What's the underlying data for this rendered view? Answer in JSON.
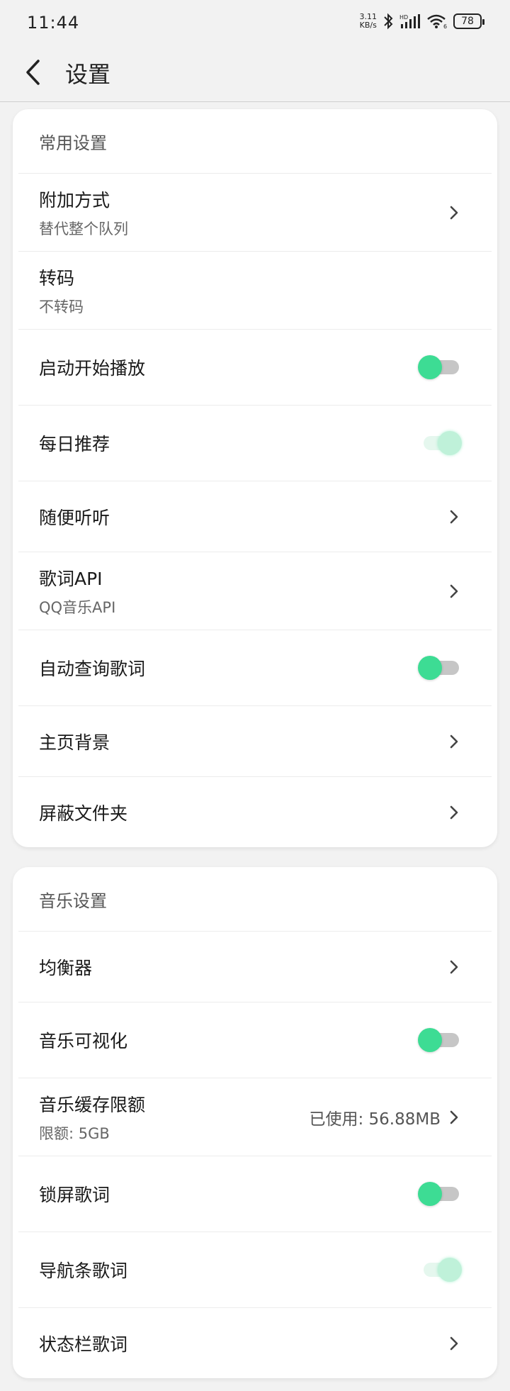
{
  "status": {
    "time": "11:44",
    "speed_value": "3.11",
    "speed_unit": "KB/s",
    "battery": "78"
  },
  "header": {
    "title": "设置"
  },
  "sections": [
    {
      "title": "常用设置",
      "items": [
        {
          "title": "附加方式",
          "subtitle": "替代整个队列",
          "control": "chevron"
        },
        {
          "title": "转码",
          "subtitle": "不转码",
          "control": "none"
        },
        {
          "title": "启动开始播放",
          "control": "toggle",
          "state": "off"
        },
        {
          "title": "每日推荐",
          "control": "toggle",
          "state": "on"
        },
        {
          "title": "随便听听",
          "control": "chevron"
        },
        {
          "title": "歌词API",
          "subtitle": "QQ音乐API",
          "control": "chevron"
        },
        {
          "title": "自动查询歌词",
          "control": "toggle",
          "state": "off"
        },
        {
          "title": "主页背景",
          "control": "chevron"
        },
        {
          "title": "屏蔽文件夹",
          "control": "chevron"
        }
      ]
    },
    {
      "title": "音乐设置",
      "items": [
        {
          "title": "均衡器",
          "control": "chevron"
        },
        {
          "title": "音乐可视化",
          "control": "toggle",
          "state": "off"
        },
        {
          "title": "音乐缓存限额",
          "subtitle": "限额: 5GB",
          "value": "已使用: 56.88MB",
          "control": "chevron"
        },
        {
          "title": "锁屏歌词",
          "control": "toggle",
          "state": "off"
        },
        {
          "title": "导航条歌词",
          "control": "toggle",
          "state": "on"
        },
        {
          "title": "状态栏歌词",
          "control": "chevron"
        }
      ]
    }
  ],
  "colors": {
    "accent": "#3ddc94",
    "background": "#f2f2f2",
    "card": "#ffffff"
  },
  "icons": {
    "back": "arrow-left-icon",
    "chevron": "chevron-right-icon"
  }
}
